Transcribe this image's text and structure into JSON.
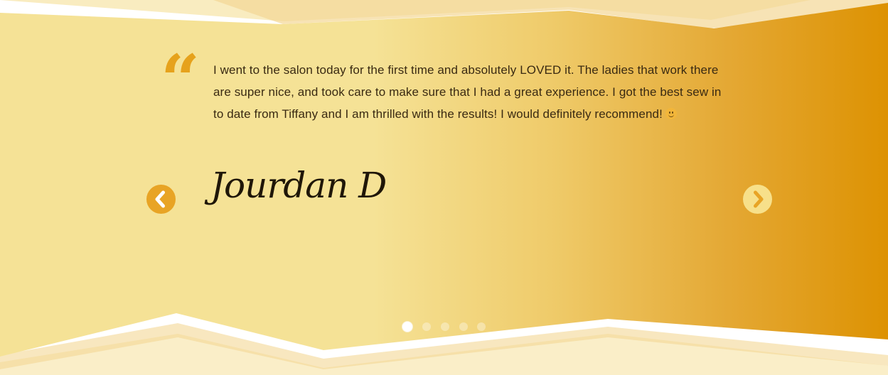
{
  "testimonial": {
    "quote_glyph": "“",
    "text": "I went to the salon today for the first time and absolutely LOVED it. The ladies that work there are super nice, and took care to make sure that I had a great experience. I got the best sew in to date from Tiffany and I am thrilled with the results! I would definitely recommend!",
    "emoji": "slightly-smiling-face-icon",
    "author": "Jourdan D"
  },
  "carousel": {
    "prev_icon": "chevron-left-icon",
    "next_icon": "chevron-right-icon",
    "slide_count": 5,
    "active_index": 0
  },
  "colors": {
    "gradient_light": "#f5e296",
    "gradient_dark": "#dd9202",
    "prev_button": "#e8a425",
    "next_button": "#f7e08a",
    "quote_mark": "#e6a21c",
    "text": "#3a2a12"
  }
}
